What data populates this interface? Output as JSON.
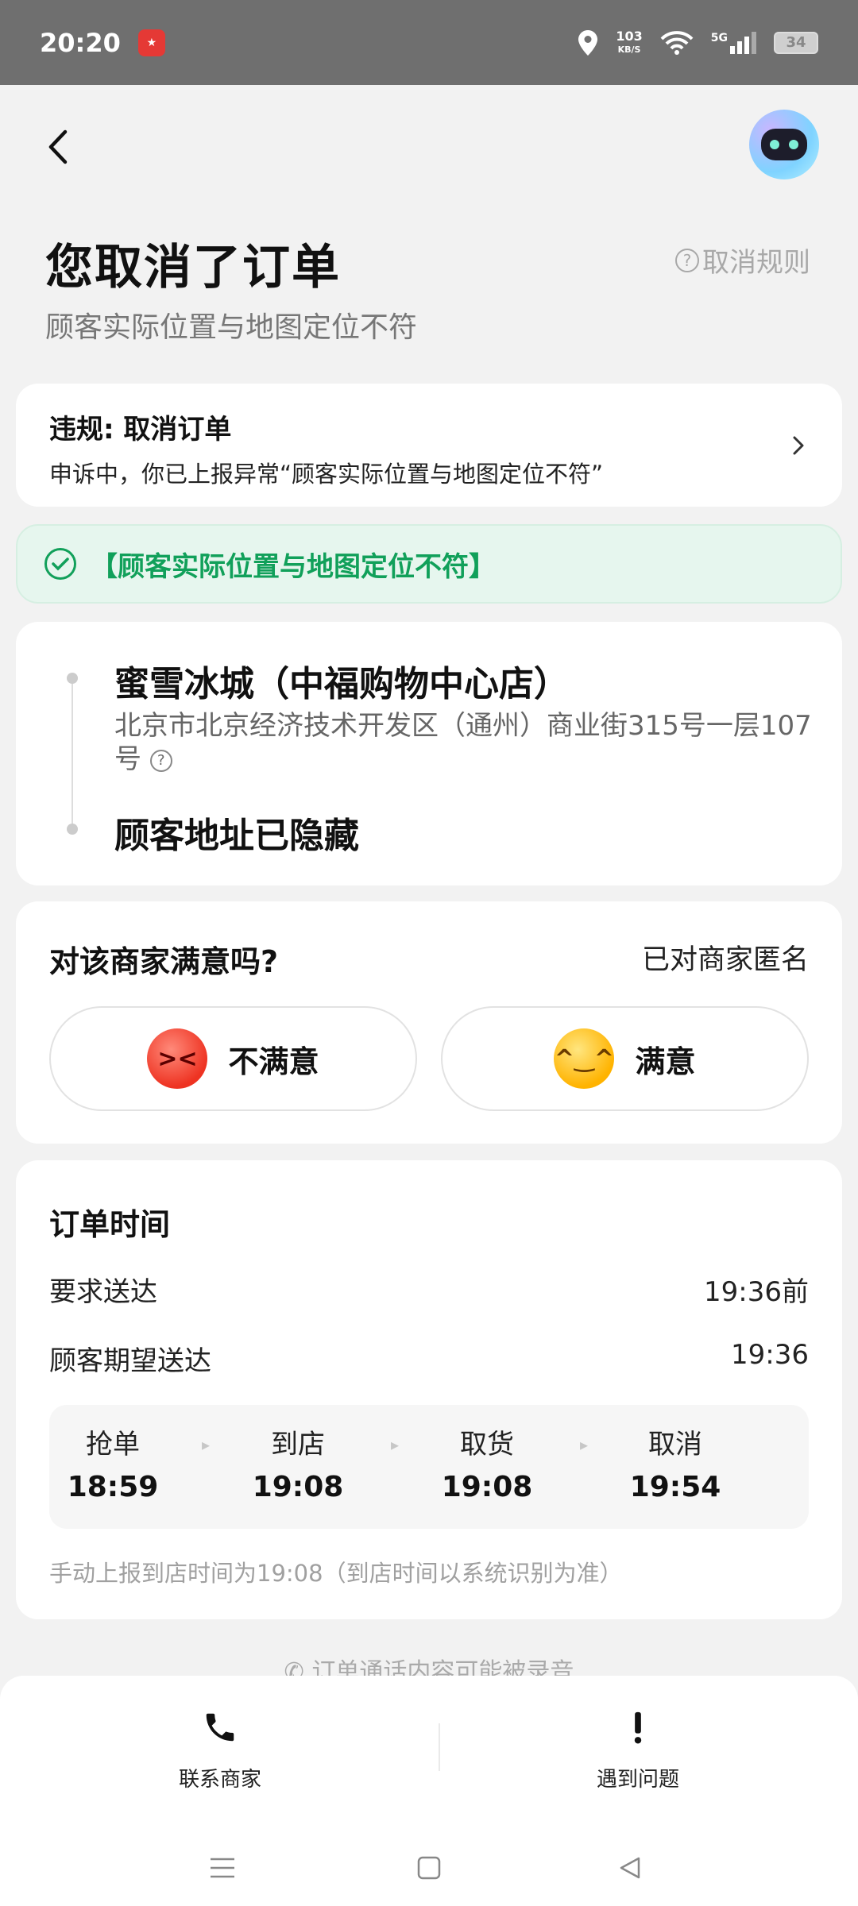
{
  "status_bar": {
    "time": "20:20",
    "network_speed_value": "103",
    "network_speed_unit": "KB/S",
    "network_type": "5G",
    "battery": "34"
  },
  "header": {
    "title": "您取消了订单",
    "subtitle": "顾客实际位置与地图定位不符",
    "cancel_rule_label": "取消规则"
  },
  "violation": {
    "title": "违规: 取消订单",
    "description": "申诉中，你已上报异常“顾客实际位置与地图定位不符”"
  },
  "reason_banner": {
    "text": "【顾客实际位置与地图定位不符】"
  },
  "address": {
    "store_name": "蜜雪冰城（中福购物中心店）",
    "store_address": "北京市北京经济技术开发区（通州）商业街315号一层107号",
    "customer_address": "顾客地址已隐藏"
  },
  "satisfaction": {
    "question": "对该商家满意吗?",
    "anonymous_label": "已对商家匿名",
    "dissatisfied_label": "不满意",
    "satisfied_label": "满意"
  },
  "order_time": {
    "title": "订单时间",
    "required_label": "要求送达",
    "required_value": "19:36前",
    "expected_label": "顾客期望送达",
    "expected_value": "19:36",
    "steps": [
      {
        "label": "抢单",
        "time": "18:59"
      },
      {
        "label": "到店",
        "time": "19:08"
      },
      {
        "label": "取货",
        "time": "19:08"
      },
      {
        "label": "取消",
        "time": "19:54"
      }
    ],
    "manual_note": "手动上报到店时间为19:08（到店时间以系统识别为准）"
  },
  "recording_note": "订单通话内容可能被录音",
  "bottom_bar": {
    "contact_label": "联系商家",
    "problem_label": "遇到问题"
  },
  "colors": {
    "accent_green": "#11a05a",
    "status_bar": "#6f6f6f"
  }
}
